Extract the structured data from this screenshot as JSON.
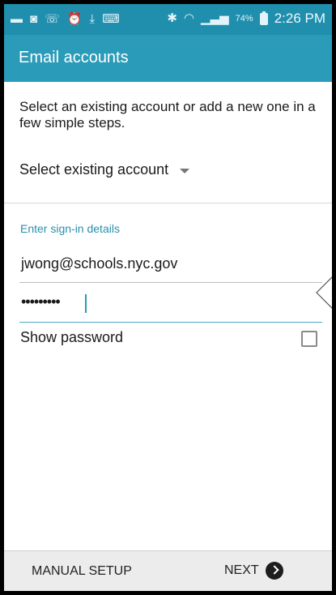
{
  "statusbar": {
    "battery_percent": "74%",
    "time": "2:26 PM",
    "icons_left": [
      "message-icon",
      "media-icon",
      "wifi-call-icon",
      "alarm-icon",
      "download-icon",
      "keyboard-icon"
    ],
    "icons_right": [
      "bluetooth-icon",
      "wifi-icon",
      "signal-icon",
      "battery-icon"
    ]
  },
  "appbar": {
    "title": "Email accounts"
  },
  "intro": {
    "text": "Select an existing account or add a new one in a few simple steps."
  },
  "select_existing": {
    "label": "Select existing account"
  },
  "signin": {
    "section_label": "Enter sign-in details",
    "email_value": "jwong@schools.nyc.gov",
    "password_value": "•••••••••"
  },
  "show_password": {
    "label": "Show password",
    "checked": false
  },
  "bottombar": {
    "manual_label": "MANUAL SETUP",
    "next_label": "NEXT"
  },
  "colors": {
    "statusbar": "#1f8fad",
    "appbar": "#2a9bb8",
    "accent": "#2a8fab"
  }
}
